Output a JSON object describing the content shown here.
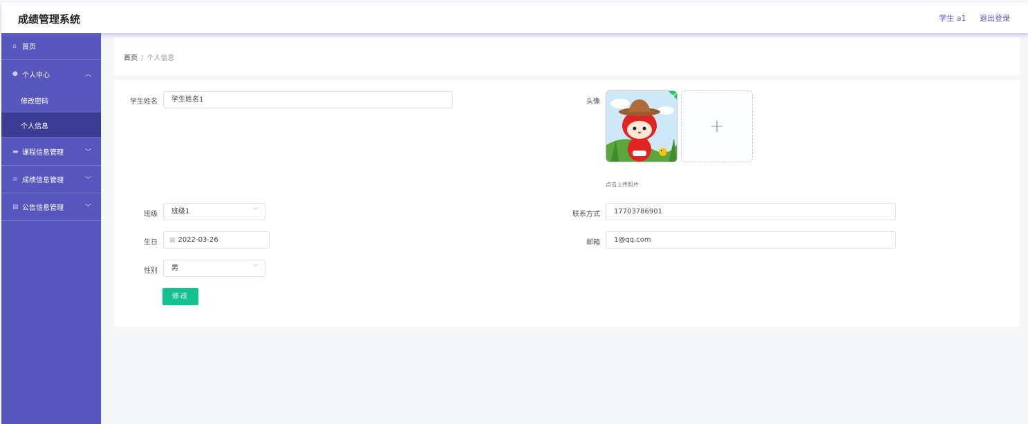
{
  "app": {
    "title": "成绩管理系统"
  },
  "header": {
    "user": "学生 a1",
    "logout": "退出登录"
  },
  "sidebar": {
    "home": "首页",
    "personal_center": "个人中心",
    "change_password": "修改密码",
    "personal_info": "个人信息",
    "course_mgmt": "课程信息管理",
    "score_mgmt": "成绩信息管理",
    "notice_mgmt": "公告信息管理"
  },
  "breadcrumb": {
    "home": "首页",
    "separator": "/",
    "current": "个人信息"
  },
  "form": {
    "name_label": "学生姓名",
    "name_value": "学生姓名1",
    "avatar_label": "头像",
    "avatar_plus": "+",
    "upload_tip": "点击上传照片",
    "class_label": "班级",
    "class_value": "班级1",
    "contact_label": "联系方式",
    "contact_value": "17703786901",
    "birthday_label": "生日",
    "birthday_value": "2022-03-26",
    "email_label": "邮箱",
    "email_value": "1@qq.com",
    "gender_label": "性别",
    "gender_value": "男",
    "submit": "修改"
  },
  "icons": {
    "home": "home-icon",
    "user": "user-icon",
    "course": "course-icon",
    "score": "list-icon",
    "notice": "notice-icon",
    "chevron": "chevron-icon",
    "calendar": "calendar-icon",
    "upload": "plus-icon"
  },
  "colors": {
    "sidebar": "#5656bd",
    "sidebar_active": "#3c3c95",
    "primary_button": "#13c290",
    "header_link": "#5b57c9"
  }
}
